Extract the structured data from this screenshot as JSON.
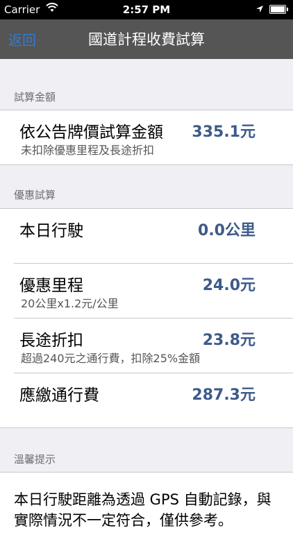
{
  "status_bar": {
    "carrier": "Carrier",
    "time": "2:57 PM"
  },
  "nav": {
    "back_label": "返回",
    "title": "國道計程收費試算"
  },
  "section_amount": {
    "header": "試算金額",
    "row_label": "依公告牌價試算金額",
    "row_value": "335.1元",
    "row_sub": "未扣除優惠里程及長途折扣"
  },
  "section_discount": {
    "header": "優惠試算",
    "today": {
      "label": "本日行駛",
      "value": "0.0公里"
    },
    "discount_mileage": {
      "label": "優惠里程",
      "value": "24.0元",
      "sub": "20公里x1.2元/公里"
    },
    "long_distance": {
      "label": "長途折扣",
      "value": "23.8元",
      "sub": "超過240元之通行費，扣除25%金額"
    },
    "payable": {
      "label": "應繳通行費",
      "value": "287.3元"
    }
  },
  "section_notice": {
    "header": "溫馨提示",
    "text": "本日行駛距離為透過 GPS 自動記錄，與實際情況不一定符合，僅供參考。"
  }
}
